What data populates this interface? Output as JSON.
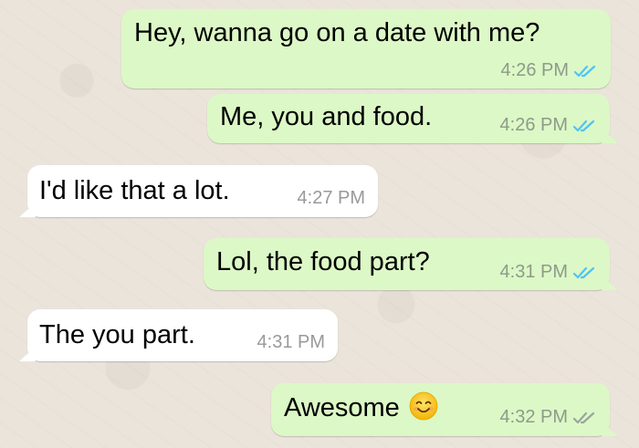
{
  "messages": [
    {
      "text": "Hey, wanna go on a date with me?",
      "time": "4:26 PM",
      "direction": "outgoing",
      "status": "read"
    },
    {
      "text": "Me, you and food.",
      "time": "4:26 PM",
      "direction": "outgoing",
      "status": "read"
    },
    {
      "text": "I'd like that a lot.",
      "time": "4:27 PM",
      "direction": "incoming"
    },
    {
      "text": "Lol, the food part?",
      "time": "4:31 PM",
      "direction": "outgoing",
      "status": "read"
    },
    {
      "text": "The you part.",
      "time": "4:31 PM",
      "direction": "incoming"
    },
    {
      "text": "Awesome",
      "time": "4:32 PM",
      "direction": "outgoing",
      "status": "delivered",
      "emoji": "smiling-face-emoji"
    }
  ],
  "colors": {
    "outgoing_bubble": "#dcf8c6",
    "incoming_bubble": "#ffffff",
    "read_tick": "#4fc3f7",
    "delivered_tick": "#9aa59a",
    "background": "#ece5dd"
  }
}
